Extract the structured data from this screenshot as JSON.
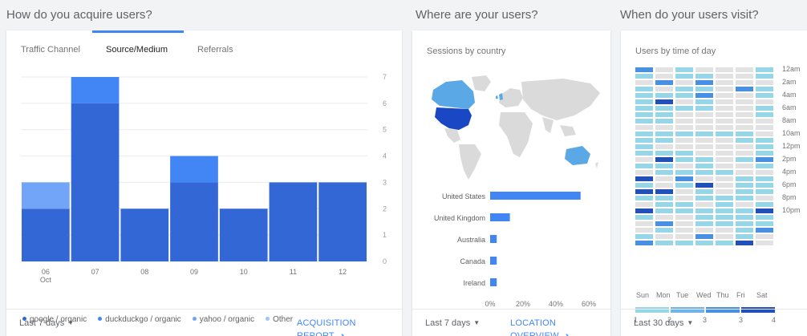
{
  "sections": {
    "acquire_title": "How do you acquire users?",
    "where_title": "Where are your users?",
    "when_title": "When do your users visit?"
  },
  "acquire": {
    "tabs": [
      {
        "label": "Traffic Channel",
        "active": false
      },
      {
        "label": "Source/Medium",
        "active": true
      },
      {
        "label": "Referrals",
        "active": false
      }
    ],
    "legend": [
      {
        "label": "google / organic",
        "color": "#3367d6"
      },
      {
        "label": "duckduckgo / organic",
        "color": "#4285f4"
      },
      {
        "label": "yahoo / organic",
        "color": "#72a4f7"
      },
      {
        "label": "Other",
        "color": "#a1c2fa"
      }
    ],
    "footer": {
      "range": "Last 7 days",
      "link": "ACQUISITION REPORT"
    }
  },
  "where": {
    "subtitle": "Sessions by country",
    "footer": {
      "range": "Last 7 days",
      "link": "LOCATION OVERVIEW"
    }
  },
  "when": {
    "subtitle": "Users by time of day",
    "hour_labels": [
      "12am",
      "2am",
      "4am",
      "6am",
      "8am",
      "10am",
      "12pm",
      "2pm",
      "4pm",
      "6pm",
      "8pm",
      "10pm"
    ],
    "day_labels": [
      "Sun",
      "Mon",
      "Tue",
      "Wed",
      "Thu",
      "Fri",
      "Sat"
    ],
    "scale_labels": [
      "1",
      "2",
      "3",
      "3",
      "4"
    ],
    "colors": [
      "#e2e2e2",
      "#97d6e6",
      "#4a90e2",
      "#2350b8"
    ],
    "levels": [
      [
        2,
        0,
        1,
        0,
        0,
        0,
        1
      ],
      [
        1,
        0,
        1,
        1,
        0,
        0,
        1
      ],
      [
        0,
        2,
        0,
        2,
        0,
        0,
        0
      ],
      [
        1,
        0,
        1,
        1,
        0,
        2,
        1
      ],
      [
        1,
        1,
        1,
        2,
        0,
        0,
        1
      ],
      [
        1,
        3,
        0,
        1,
        0,
        0,
        0
      ],
      [
        1,
        1,
        1,
        1,
        0,
        0,
        1
      ],
      [
        1,
        1,
        0,
        0,
        0,
        0,
        1
      ],
      [
        1,
        1,
        0,
        0,
        0,
        0,
        0
      ],
      [
        0,
        0,
        0,
        0,
        0,
        0,
        0
      ],
      [
        1,
        1,
        1,
        1,
        1,
        1,
        0
      ],
      [
        1,
        1,
        0,
        0,
        0,
        1,
        1
      ],
      [
        1,
        0,
        0,
        0,
        0,
        0,
        1
      ],
      [
        1,
        1,
        1,
        0,
        0,
        0,
        1
      ],
      [
        0,
        3,
        1,
        1,
        0,
        1,
        2
      ],
      [
        1,
        1,
        0,
        1,
        0,
        0,
        1
      ],
      [
        0,
        1,
        1,
        1,
        1,
        0,
        0
      ],
      [
        3,
        0,
        2,
        0,
        0,
        1,
        1
      ],
      [
        1,
        0,
        1,
        3,
        0,
        1,
        1
      ],
      [
        3,
        3,
        0,
        1,
        0,
        1,
        1
      ],
      [
        1,
        1,
        0,
        1,
        1,
        1,
        0
      ],
      [
        0,
        1,
        1,
        0,
        1,
        0,
        1
      ],
      [
        3,
        1,
        1,
        1,
        1,
        1,
        3
      ],
      [
        1,
        0,
        0,
        1,
        1,
        1,
        1
      ],
      [
        0,
        2,
        0,
        1,
        1,
        1,
        1
      ],
      [
        0,
        1,
        0,
        0,
        0,
        1,
        2
      ],
      [
        1,
        0,
        0,
        2,
        0,
        1,
        0
      ],
      [
        2,
        1,
        1,
        1,
        1,
        3,
        0
      ]
    ],
    "footer": {
      "range": "Last 30 days"
    }
  },
  "chart_data": [
    {
      "type": "bar",
      "title": "",
      "categories": [
        "06",
        "07",
        "08",
        "09",
        "10",
        "11",
        "12"
      ],
      "category_sublabel": "Oct",
      "series": [
        {
          "name": "google / organic",
          "values": [
            2,
            6,
            2,
            3,
            2,
            3,
            3
          ]
        },
        {
          "name": "duckduckgo / organic",
          "values": [
            0,
            1,
            0,
            1,
            0,
            0,
            0
          ]
        },
        {
          "name": "yahoo / organic",
          "values": [
            1,
            0,
            0,
            0,
            0,
            0,
            0
          ]
        }
      ],
      "stacked": true,
      "ylim": [
        0,
        7
      ],
      "yticks": [
        0,
        1,
        2,
        3,
        4,
        5,
        6,
        7
      ],
      "colors": [
        "#3367d6",
        "#4285f4",
        "#72a4f7"
      ],
      "grid": true,
      "y_axis_side": "right",
      "legend_position": "bottom"
    },
    {
      "type": "bar",
      "orientation": "horizontal",
      "categories": [
        "United States",
        "United Kingdom",
        "Australia",
        "Canada",
        "Ireland"
      ],
      "values": [
        55,
        12,
        4,
        4,
        4
      ],
      "xlim": [
        0,
        60
      ],
      "xticks": [
        "0%",
        "20%",
        "40%",
        "60%"
      ],
      "color": "#4285f4"
    }
  ]
}
